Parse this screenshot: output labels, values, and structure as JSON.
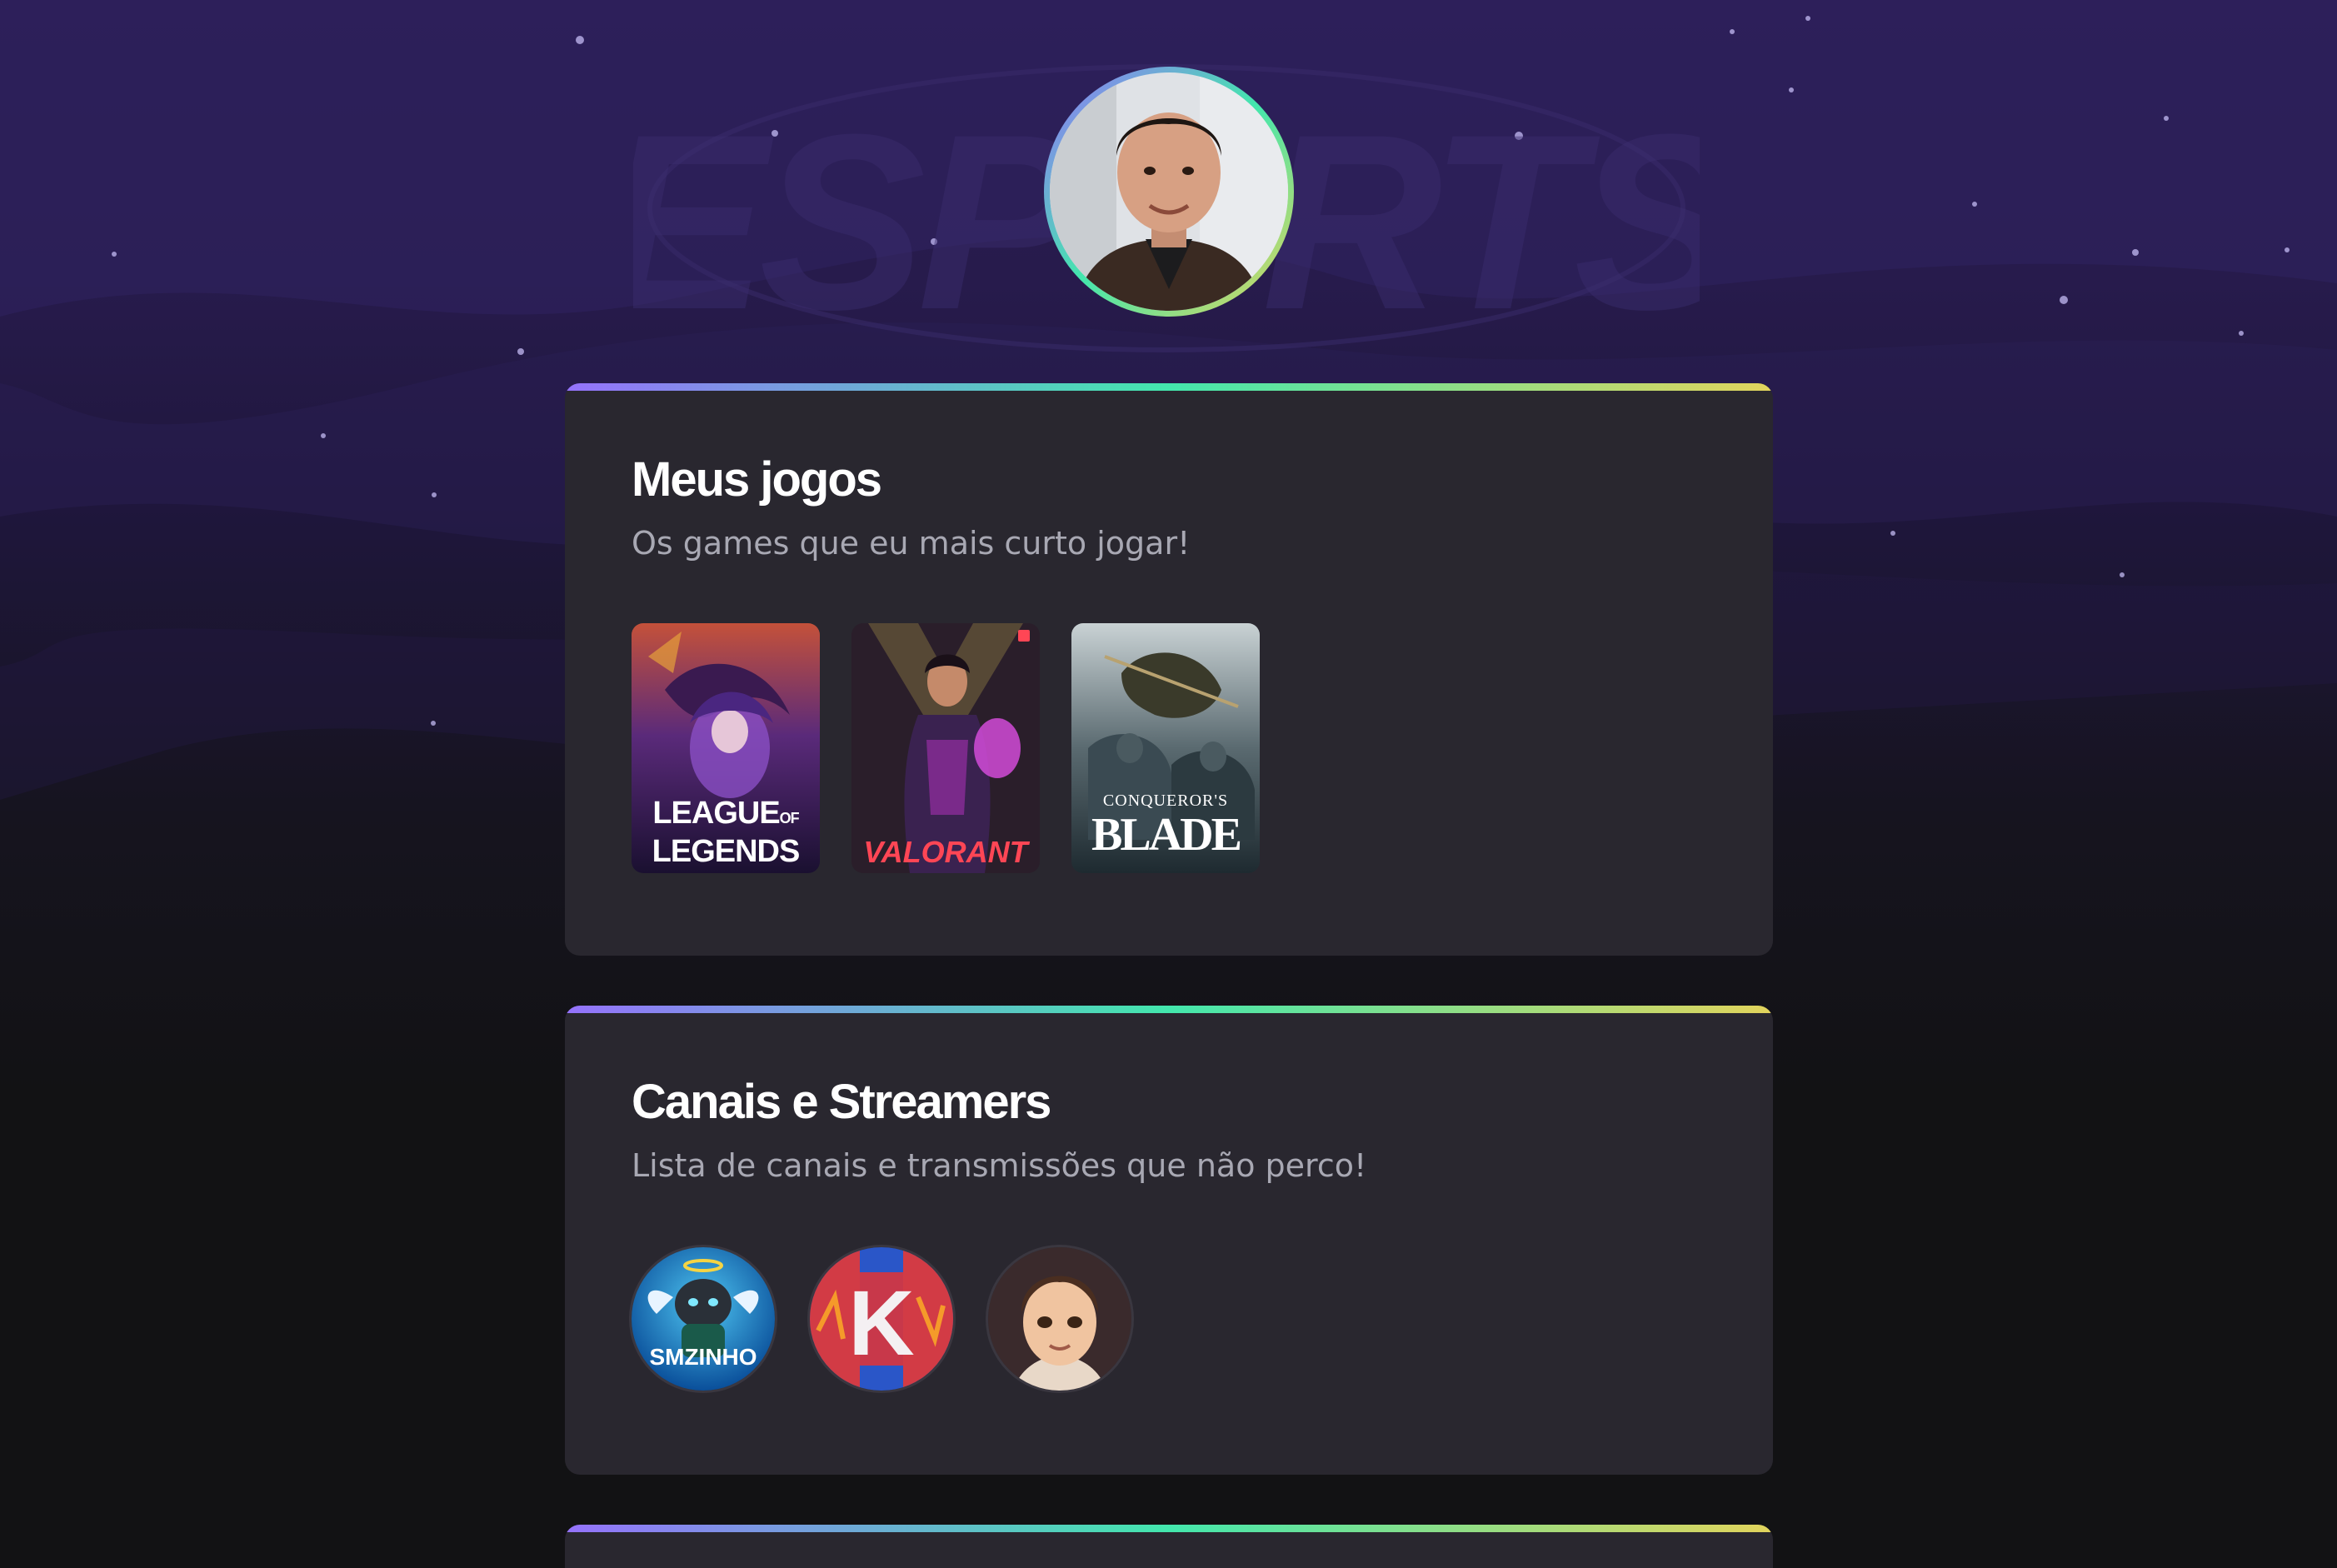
{
  "profile": {
    "avatar_icon": "profile-photo"
  },
  "background": {
    "watermark_text": "ESPORTS"
  },
  "games_section": {
    "title": "Meus jogos",
    "subtitle": "Os games que eu mais curto jogar!",
    "games": [
      {
        "name": "League of Legends",
        "label_line1": "LEAGUE",
        "label_of": "OF",
        "label_line2": "LEGENDS",
        "accent": "#7b3fb8"
      },
      {
        "name": "Valorant",
        "label": "VALORANT",
        "accent": "#e0384f"
      },
      {
        "name": "Conqueror's Blade",
        "label_small": "CONQUEROR'S",
        "label": "BLADE",
        "accent": "#4a6470"
      }
    ]
  },
  "channels_section": {
    "title": "Canais e Streamers",
    "subtitle": "Lista de canais e transmissões que não perco!",
    "channels": [
      {
        "name": "SMZINHO",
        "label": "SMZINHO",
        "accent": "#1b8fd6"
      },
      {
        "name": "K channel",
        "label": "K",
        "accent": "#d23b45"
      },
      {
        "name": "Cartoon streamer",
        "accent": "#6a4a3c"
      }
    ]
  },
  "colors": {
    "gradient_start": "#9572fc",
    "gradient_mid": "#43e7ad",
    "gradient_end": "#e2d45c",
    "card_bg": "#29272f",
    "text_primary": "#ffffff",
    "text_secondary": "#a8a8b3"
  }
}
